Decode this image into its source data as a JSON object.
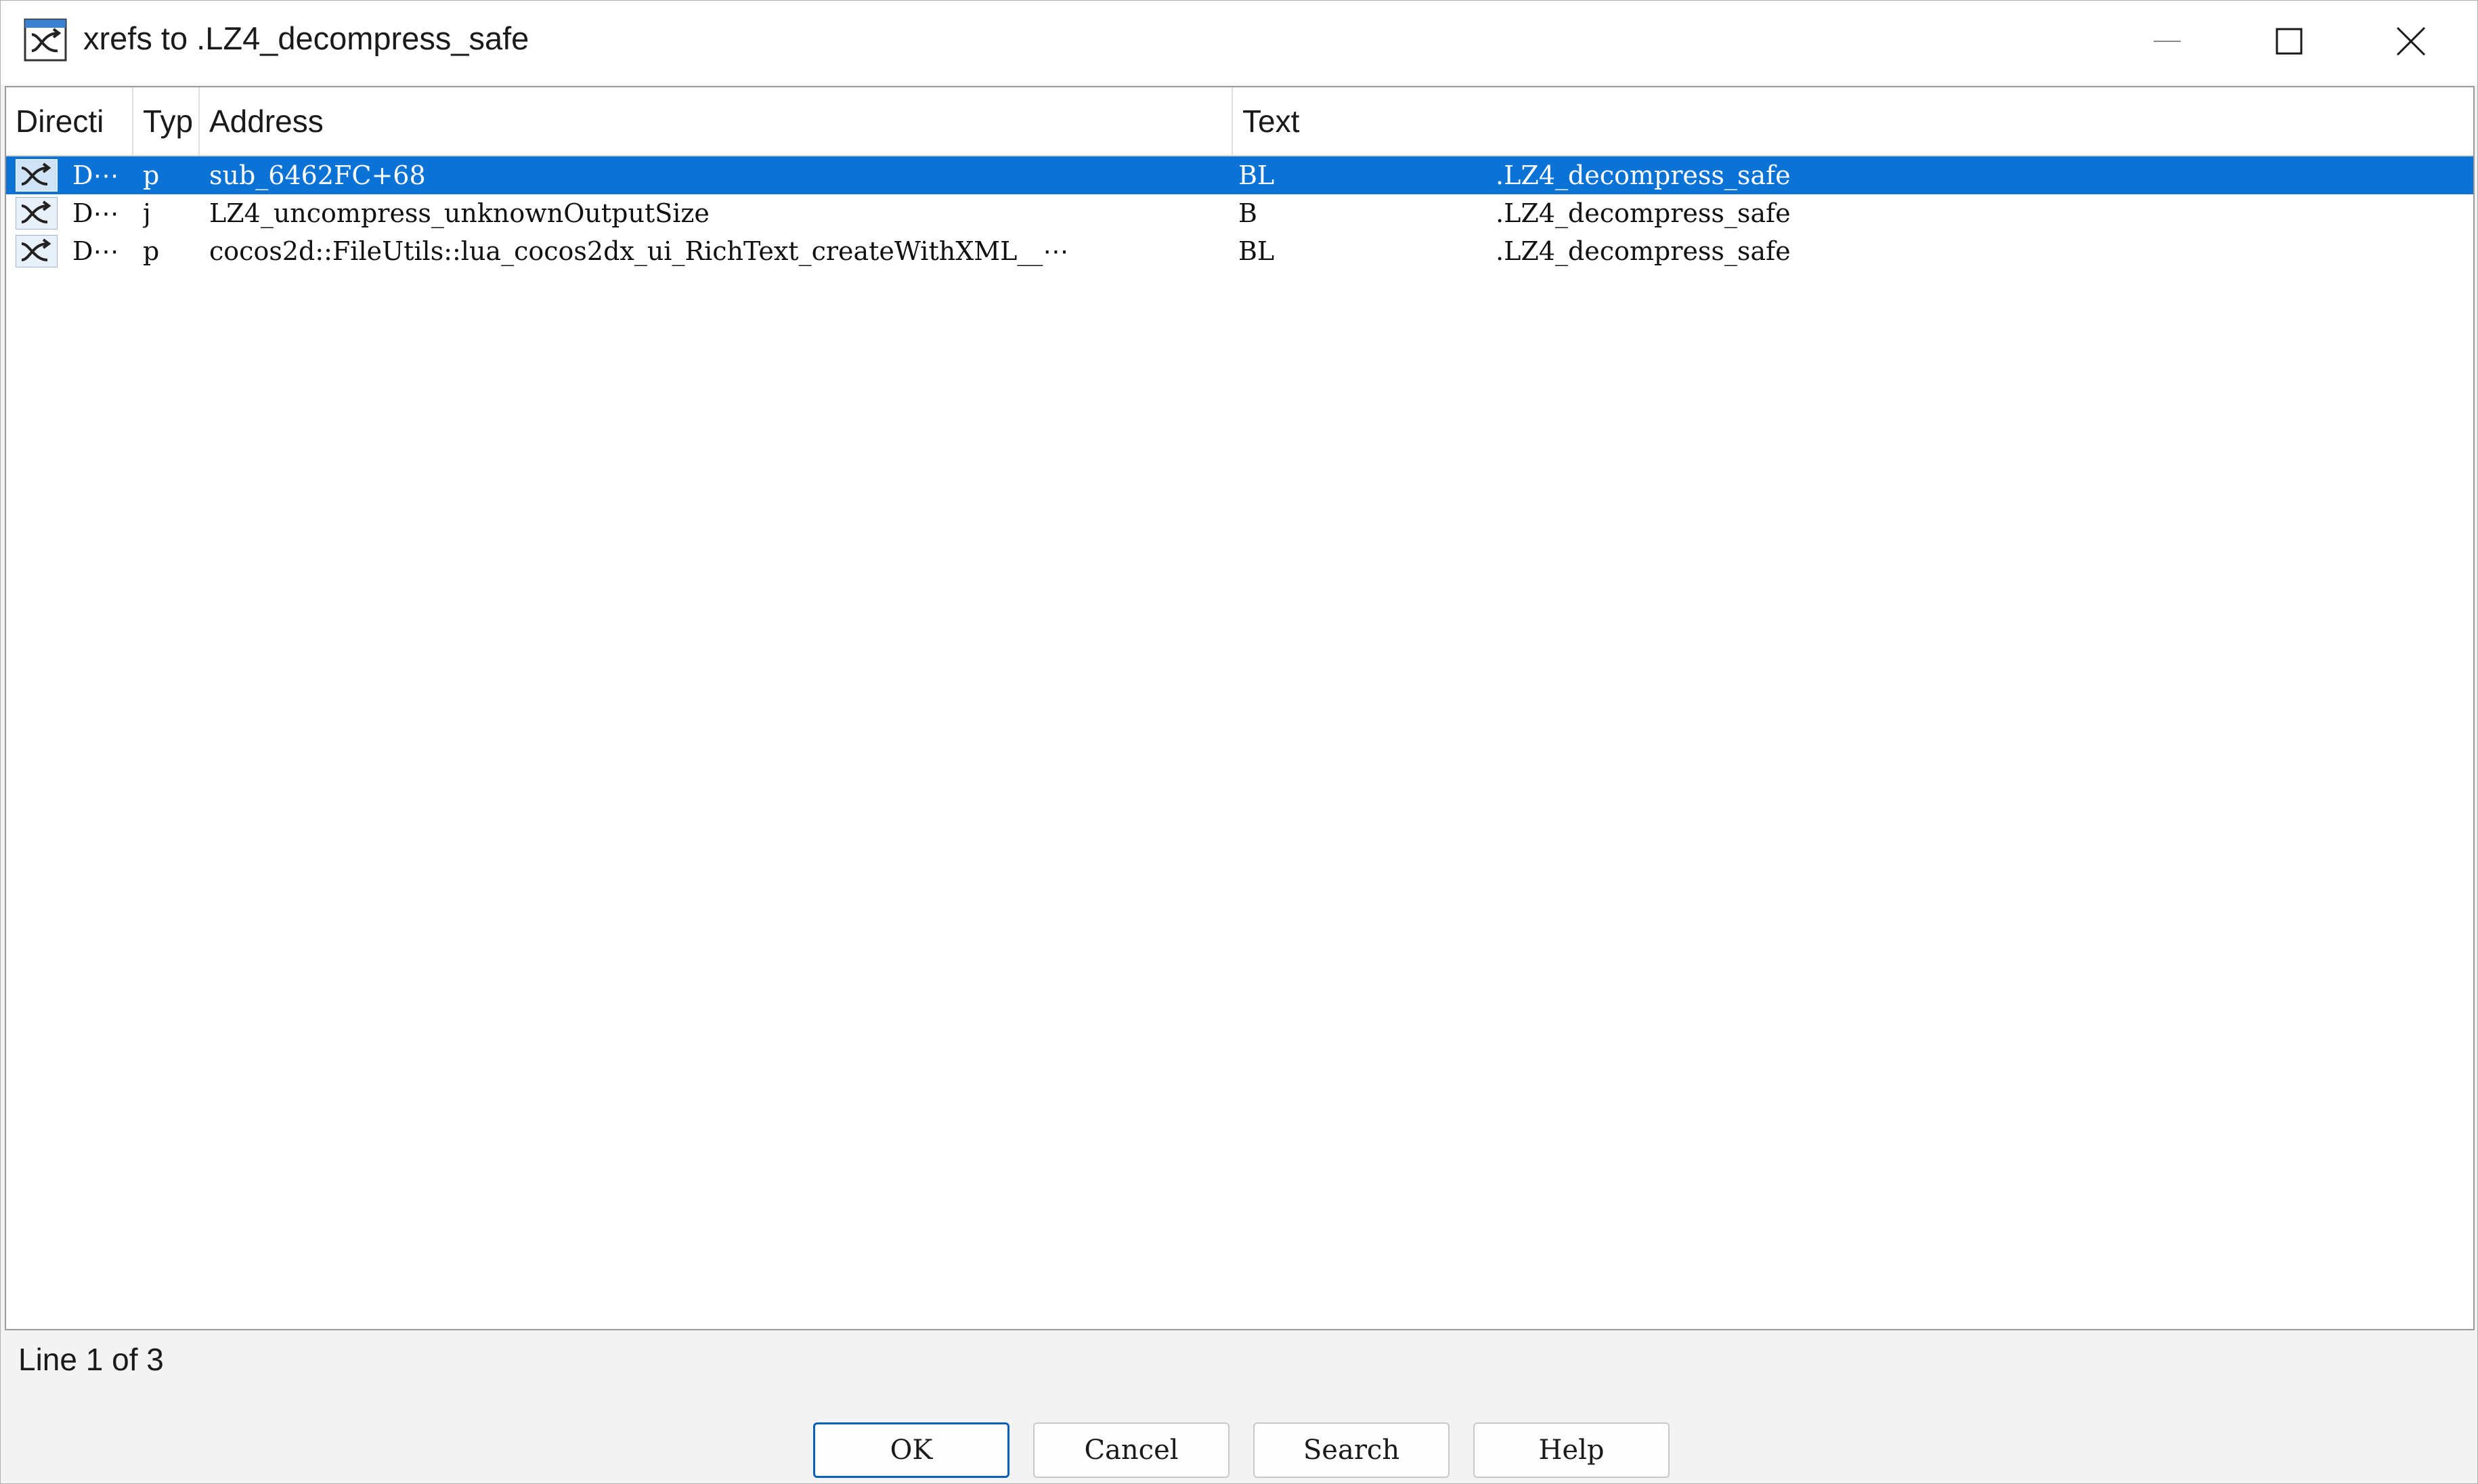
{
  "window": {
    "title": "xrefs to .LZ4_decompress_safe",
    "icon": "xref-icon",
    "controls": [
      "minimize-icon",
      "maximize-icon",
      "close-icon"
    ]
  },
  "table": {
    "columns": [
      "Directi",
      "Typ",
      "Address",
      "Text"
    ],
    "rows": [
      {
        "direction": "D⋯",
        "type": "p",
        "address": "sub_6462FC+68",
        "text_op": "BL",
        "text_arg": ".LZ4_decompress_safe",
        "selected": true
      },
      {
        "direction": "D⋯",
        "type": "j",
        "address": "LZ4_uncompress_unknownOutputSize",
        "text_op": "B",
        "text_arg": ".LZ4_decompress_safe",
        "selected": false
      },
      {
        "direction": "D⋯",
        "type": "p",
        "address": "cocos2d::FileUtils::lua_cocos2dx_ui_RichText_createWithXML__⋯",
        "text_op": "BL",
        "text_arg": ".LZ4_decompress_safe",
        "selected": false
      }
    ]
  },
  "status": "Line 1 of 3",
  "buttons": {
    "ok": "OK",
    "cancel": "Cancel",
    "search": "Search",
    "help": "Help"
  },
  "colors": {
    "selection": "#0b72d6",
    "default_button_border": "#0b5fb5"
  }
}
